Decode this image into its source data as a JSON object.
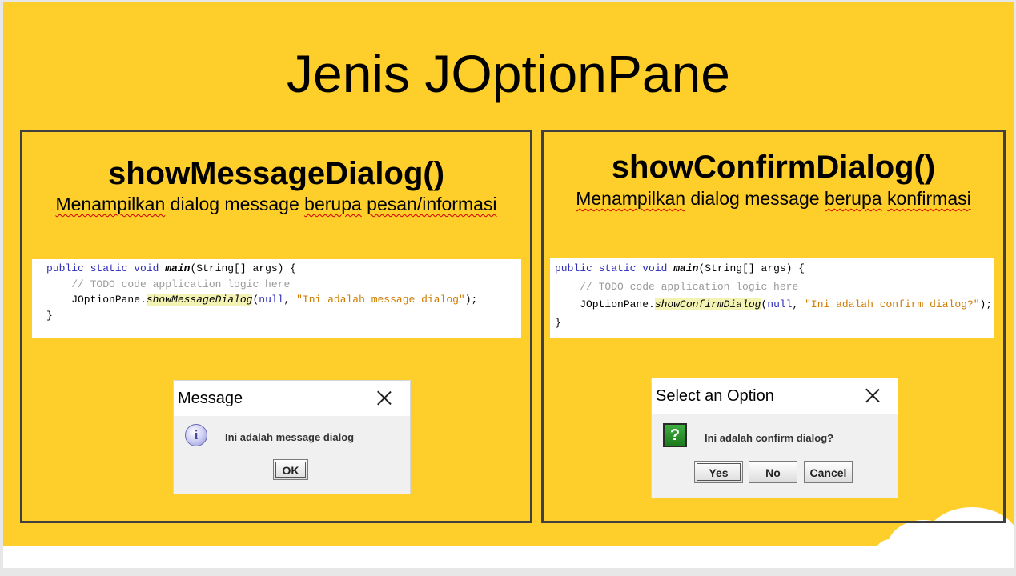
{
  "slide": {
    "title": "Jenis JOptionPane"
  },
  "left_panel": {
    "heading": "showMessageDialog()",
    "desc_part1": "Menampilkan",
    "desc_part2": " dialog message ",
    "desc_part3": "berupa",
    "desc_part4": " ",
    "desc_part5": "pesan/informasi",
    "code": {
      "l1_kw": "public static void ",
      "l1_main": "main",
      "l1_rest": "(String[] args) {",
      "l2": "    // TODO code application logic here",
      "l3_pre": "    JOptionPane.",
      "l3_method": "showMessageDialog",
      "l3_open": "(",
      "l3_null": "null",
      "l3_comma": ", ",
      "l3_str": "\"Ini adalah message dialog\"",
      "l3_close": ");",
      "l4": "}"
    },
    "dialog": {
      "title": "Message",
      "message": "Ini adalah message dialog",
      "icon": "i",
      "ok_label": "OK"
    }
  },
  "right_panel": {
    "heading": "showConfirmDialog()",
    "desc_part1": "Menampilkan",
    "desc_part2": " dialog message ",
    "desc_part3": "berupa",
    "desc_part4": " ",
    "desc_part5": "konfirmasi",
    "code": {
      "l1_kw": "public static void ",
      "l1_main": "main",
      "l1_rest": "(String[] args) {",
      "l2": "    // TODO code application logic here",
      "l3_pre": "    JOptionPane.",
      "l3_method": "showConfirmDialog",
      "l3_open": "(",
      "l3_null": "null",
      "l3_comma": ", ",
      "l3_str": "\"Ini adalah confirm dialog?\"",
      "l3_close": ");",
      "l4": "}"
    },
    "dialog": {
      "title": "Select an Option",
      "message": "Ini adalah confirm dialog?",
      "icon": "?",
      "yes_label": "Yes",
      "no_label": "No",
      "cancel_label": "Cancel"
    }
  },
  "colors": {
    "slide_background": "#FECE2A",
    "panel_border": "#404040",
    "keyword": "#2c2cb8",
    "comment": "#9a9a9a",
    "string": "#ce7b00",
    "method_highlight": "#f3f3b4",
    "spellcheck_underline": "#d00000"
  }
}
